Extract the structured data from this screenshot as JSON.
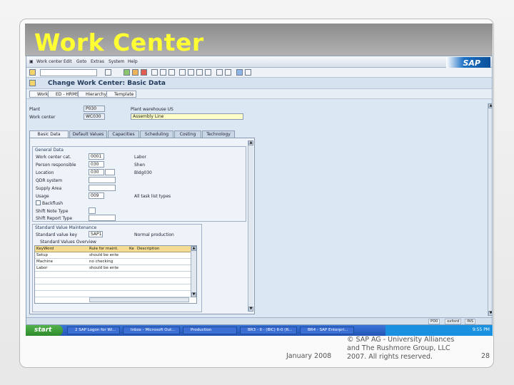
{
  "slide": {
    "title": "Work Center",
    "footer_date": "January 2008",
    "footer_copyright_1": "© SAP AG - University Alliances",
    "footer_copyright_2": "and The Rushmore Group, LLC",
    "footer_copyright_3": "2007. All rights reserved.",
    "page_number": "28"
  },
  "sap": {
    "menu": [
      "Work center",
      "Edit",
      "Goto",
      "Extras",
      "System",
      "Help"
    ],
    "logo": "SAP",
    "screen_title": "Change Work Center: Basic Data",
    "app_toolbar": [
      "Work center",
      "ED - HRMS",
      "Hierarchy",
      "Template"
    ],
    "header": {
      "plant_label": "Plant",
      "plant_value": "P030",
      "plant_desc": "Plant warehouse US",
      "workcenter_label": "Work center",
      "workcenter_value": "WC030",
      "workcenter_desc": "Assembly Line"
    },
    "tabs": [
      "Basic Data",
      "Default Values",
      "Capacities",
      "Scheduling",
      "Costing",
      "Technology"
    ],
    "general": {
      "title": "General Data",
      "rows": [
        {
          "label": "Work center cat.",
          "value": "0001",
          "desc": "Labor"
        },
        {
          "label": "Person responsible",
          "value": "030",
          "desc": "Shen"
        },
        {
          "label": "Location",
          "value": "030",
          "desc": "Bldg030"
        },
        {
          "label": "QDR system",
          "value": "",
          "desc": ""
        },
        {
          "label": "Supply Area",
          "value": "",
          "desc": ""
        },
        {
          "label": "Usage",
          "value": "009",
          "desc": "All task list types"
        }
      ],
      "backflush_label": "Backflush",
      "shift_note_label": "Shift Note Type",
      "shift_report_label": "Shift Report Type"
    },
    "standard": {
      "title": "Standard Value Maintenance",
      "key_label": "Standard value key",
      "key_value": "SAP1",
      "key_desc": "Normal production",
      "overview_label": "Standard Values Overview",
      "columns": [
        "KeyWord",
        "Rule for maint.",
        "Ke",
        "Description"
      ],
      "rows": [
        {
          "keyword": "Setup",
          "rule": "should be ente"
        },
        {
          "keyword": "Machine",
          "rule": "no checking"
        },
        {
          "keyword": "Labor",
          "rule": "should be ente"
        }
      ]
    },
    "status": {
      "transaction": "P00",
      "server": "oxford",
      "mode": "INS"
    }
  },
  "taskbar": {
    "start_label": "start",
    "tasks": [
      "2 SAP Logon for Wi...",
      "Inbox - Microsoft Out...",
      "Production",
      "BR3 - II - (BIC) 6-0 (R...",
      "BR4 - SAP Enterpri..."
    ],
    "time": "9:55 PM"
  }
}
